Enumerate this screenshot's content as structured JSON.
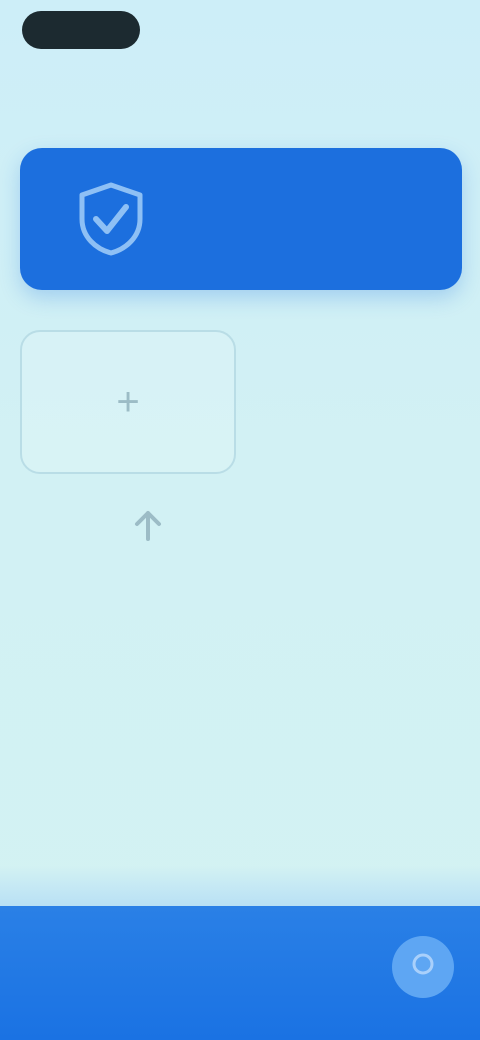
{
  "status_bar": {
    "right": ""
  },
  "header": {
    "title": ""
  },
  "hero": {
    "icon": "shield-check-icon",
    "text": ""
  },
  "add_card": {
    "icon": "plus-icon",
    "label": "+"
  },
  "hint": {
    "icon": "arrow-up-icon",
    "text": ""
  },
  "bottom_bar": {
    "fab_icon": "circle-icon"
  },
  "colors": {
    "primary": "#1c6fde",
    "background": "#cdeef8",
    "bottom_bar": "#1a72e3"
  }
}
